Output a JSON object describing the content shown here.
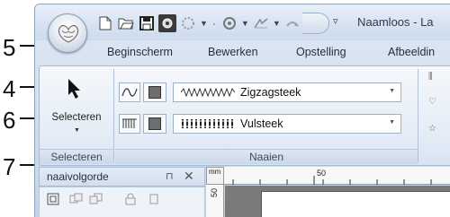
{
  "callouts": [
    "5",
    "4",
    "6",
    "7"
  ],
  "window": {
    "title": "Naamloos - La",
    "quick_access": [
      "new-icon",
      "open-icon",
      "save-icon",
      "settings-icon",
      "undo-icon",
      "redo-icon",
      "rotate-icon",
      "mirror-icon"
    ]
  },
  "tabs": [
    "Beginscherm",
    "Bewerken",
    "Opstelling",
    "Afbeeldin"
  ],
  "ribbon": {
    "select_group": {
      "button_label": "Selecteren",
      "group_label": "Selecteren"
    },
    "sew_group": {
      "group_label": "Naaien",
      "line_stitch": {
        "value": "Zigzagsteek",
        "color": "#6e6e6e"
      },
      "region_stitch": {
        "value": "Vulsteek",
        "color": "#6e6e6e"
      }
    }
  },
  "panel": {
    "title": "naaivolgorde",
    "pin": "⊓",
    "close": "✕"
  },
  "ruler": {
    "unit": "mm",
    "h_label": "50",
    "v_label": "50"
  },
  "colors": {
    "ribbon_bg": "#e4ecf6",
    "window_border": "#8ea3bc",
    "canvas": "#7a7a7a"
  }
}
